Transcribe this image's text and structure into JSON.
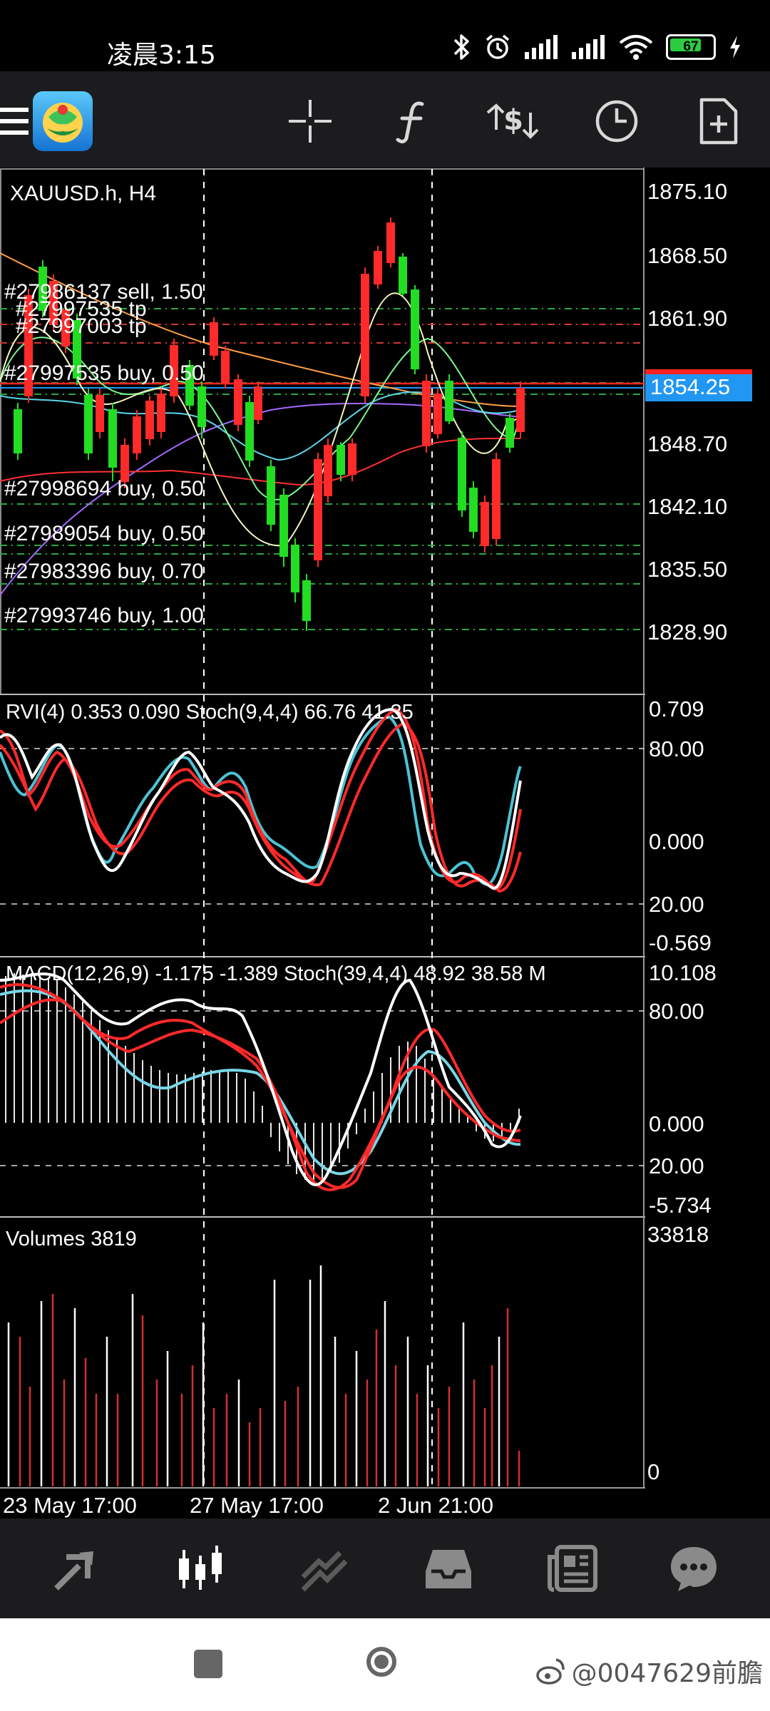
{
  "status": {
    "time": "凌晨3:15",
    "battery": "67"
  },
  "toolbar": {
    "icons": [
      "menu-icon",
      "metatrader-logo",
      "crosshair-icon",
      "indicators-icon",
      "trade-icon",
      "timeframe-icon",
      "new-order-icon"
    ]
  },
  "chart": {
    "symbol_label": "XAUUSD.h, H4",
    "current_price": "1854.25",
    "price_axis": [
      "1875.10",
      "1868.50",
      "1861.90",
      "1848.70",
      "1842.10",
      "1835.50",
      "1828.90"
    ],
    "orders": [
      {
        "label": "#27986137 sell, 1.50"
      },
      {
        "label": "#27997535 tp"
      },
      {
        "label": "#27997003 tp"
      },
      {
        "label": "#27997535 buy, 0.50"
      },
      {
        "label": "#27998694 buy, 0.50"
      },
      {
        "label": "#27989054 buy, 0.50"
      },
      {
        "label": "#27983396 buy, 0.70"
      },
      {
        "label": "#27993746 buy, 1.00"
      }
    ],
    "rvi_panel": {
      "label": "RVI(4) 0.353 0.090 Stoch(9,4,4) 66.76 41.35",
      "axis": [
        "0.709",
        "80.00",
        "0.000",
        "20.00",
        "-0.569"
      ]
    },
    "macd_panel": {
      "label": "MACD(12,26,9) -1.175 -1.389 Stoch(39,4,4) 48.92 38.58 M",
      "axis": [
        "10.108",
        "80.00",
        "0.000",
        "20.00",
        "-5.734"
      ]
    },
    "volume_panel": {
      "label": "Volumes 3819",
      "axis": [
        "33818",
        "0"
      ]
    },
    "time_axis": [
      "23 May 17:00",
      "27 May 17:00",
      "2 Jun 21:00"
    ]
  },
  "bottom_nav": {
    "items": [
      {
        "icon": "quotes-icon"
      },
      {
        "icon": "chart-icon",
        "active": true
      },
      {
        "icon": "trade-icon"
      },
      {
        "icon": "history-icon"
      },
      {
        "icon": "news-icon"
      },
      {
        "icon": "chat-icon"
      }
    ]
  },
  "watermark": "@0047629前膽",
  "colors": {
    "bull": "#22dd22",
    "bear": "#ee2222",
    "tp_line": "#d23535",
    "buy_line": "#2aa845",
    "price_badge": "#2196f3"
  }
}
